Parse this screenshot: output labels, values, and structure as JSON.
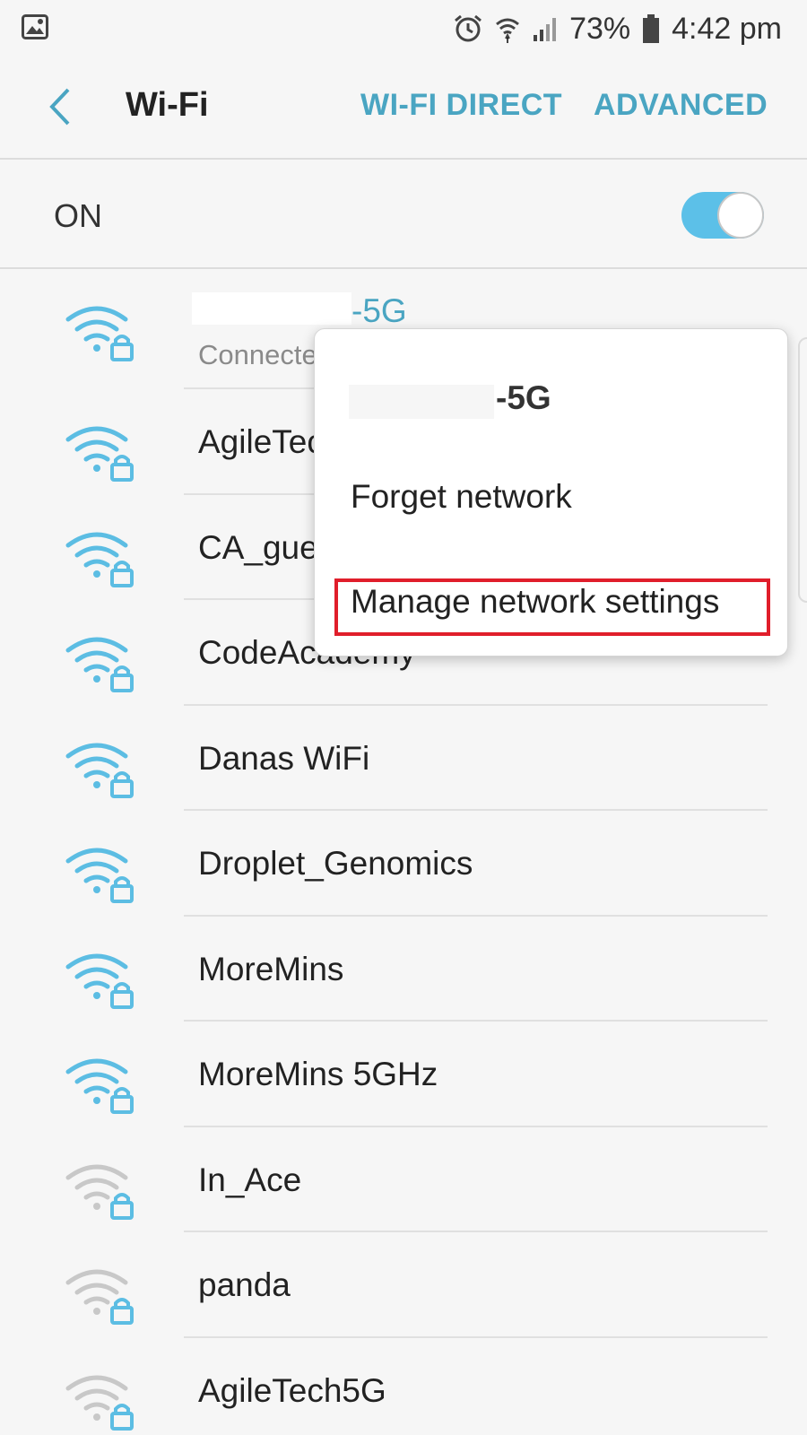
{
  "status_bar": {
    "battery": "73%",
    "time": "4:42 pm",
    "icons": [
      "gallery-icon",
      "alarm-icon",
      "wifi-icon",
      "signal-icon",
      "battery-icon"
    ]
  },
  "app_bar": {
    "title": "Wi-Fi",
    "wifi_direct": "WI-FI DIRECT",
    "advanced": "ADVANCED"
  },
  "toggle": {
    "label": "ON",
    "state": "on"
  },
  "networks": {
    "connected": {
      "name": "-5G",
      "status": "Connected"
    },
    "items": [
      {
        "name": "AgileTech",
        "signal": "strong"
      },
      {
        "name": "CA_guest",
        "signal": "strong"
      },
      {
        "name": "CodeAcademy",
        "signal": "strong"
      },
      {
        "name": "Danas WiFi",
        "signal": "strong"
      },
      {
        "name": "Droplet_Genomics",
        "signal": "strong"
      },
      {
        "name": "MoreMins",
        "signal": "strong"
      },
      {
        "name": "MoreMins 5GHz",
        "signal": "strong"
      },
      {
        "name": "In_Ace",
        "signal": "weak"
      },
      {
        "name": "panda",
        "signal": "weak"
      },
      {
        "name": "AgileTech5G",
        "signal": "weak"
      }
    ]
  },
  "popup": {
    "title": "-5G",
    "forget": "Forget network",
    "manage": "Manage network settings"
  },
  "colors": {
    "accent": "#4aa5c2",
    "toggle": "#5cc0e8",
    "wifi_strong": "#5cbde3",
    "wifi_weak": "#c8c8c8",
    "highlight": "#e01e2b"
  }
}
